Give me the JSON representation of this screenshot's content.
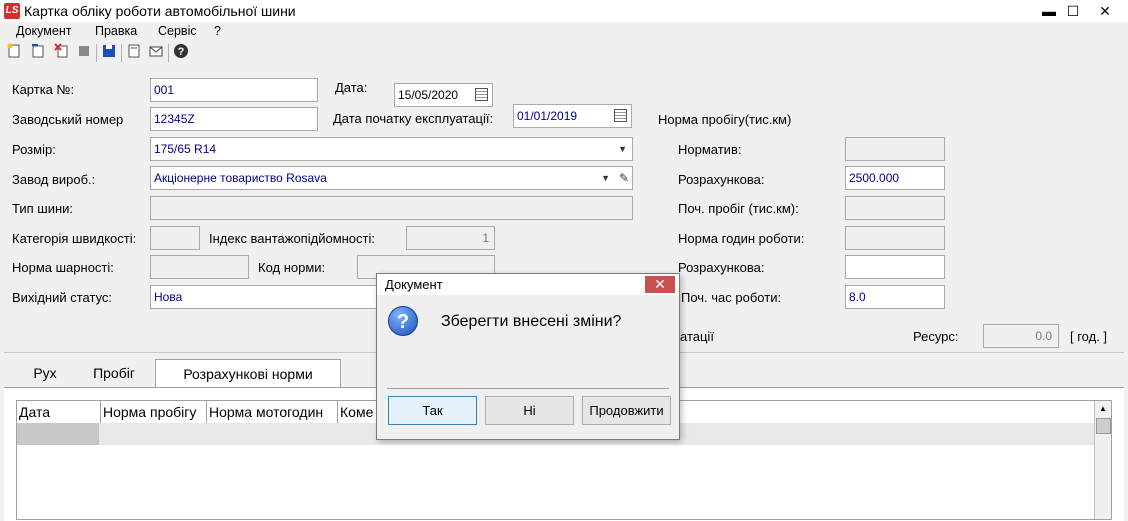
{
  "window": {
    "title": "Картка обліку роботи автомобільної шини",
    "logo": "LS",
    "controls": {
      "minimize": "▬",
      "maximize": "☐",
      "close": "✕"
    }
  },
  "menu": [
    "Документ",
    "Правка",
    "Сервіс",
    "?"
  ],
  "toolbar_icons": [
    "new-icon",
    "copy-icon",
    "delete-icon",
    "stamp-icon",
    "save-icon",
    "document-icon",
    "mail-icon",
    "help-icon"
  ],
  "form": {
    "card_no_label": "Картка №:",
    "card_no": "001",
    "date_label": "Дата:",
    "date": "15/05/2020",
    "serial_label": "Заводський номер",
    "serial": "12345Z",
    "start_date_label": "Дата початку експлуатації:",
    "start_date": "01/01/2019",
    "mileage_norm_header": "Норма пробігу(тис.км)",
    "size_label": "Розмір:",
    "size": "175/65 R14",
    "manufacturer_label": "Завод вироб.:",
    "manufacturer": "Акціонерне товариство Rosava",
    "tire_type_label": "Тип шини:",
    "speed_cat_label": "Категорія швидкості:",
    "load_index_label": "Індекс вантажопідйомності:",
    "load_index": "1",
    "tread_norm_label": "Норма шарності:",
    "norm_code_label": "Код норми:",
    "status_label": "Вихідний статус:",
    "status": "Нова",
    "normative_label": "Норматив:",
    "calc1_label": "Розрахункова:",
    "calc1": "2500.000",
    "start_mileage_label": "Поч. пробіг (тис.км):",
    "hours_norm_label": "Норма годин роботи:",
    "calc2_label": "Розрахункова:",
    "start_time_label": "Поч. час роботи:",
    "start_time": "8.0",
    "partial_label": "атації",
    "resource_label": "Ресурс:",
    "resource": "0.0",
    "resource_unit": "[ год. ]"
  },
  "tabs": [
    "Рух",
    "Пробіг",
    "Розрахункові норми"
  ],
  "grid": {
    "columns": [
      "Дата",
      "Норма пробігу",
      "Норма мотогодин",
      "Коме"
    ]
  },
  "dialog": {
    "title": "Документ",
    "message": "Зберегти внесені зміни?",
    "buttons": {
      "yes": "Так",
      "no": "Ні",
      "continue": "Продовжити"
    }
  }
}
